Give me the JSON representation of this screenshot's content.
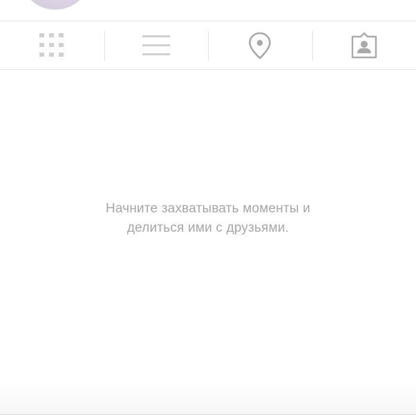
{
  "profile": {
    "avatar": "profile-avatar"
  },
  "tabs": [
    {
      "icon": "grid-icon",
      "active": false
    },
    {
      "icon": "list-icon",
      "active": false
    },
    {
      "icon": "location-pin-icon",
      "active": false
    },
    {
      "icon": "tagged-person-icon",
      "active": false
    }
  ],
  "empty_state": {
    "message": "Начните захватывать моменты и\nделиться ими с друзьями."
  },
  "colors": {
    "icon": "#a9a9a9",
    "icon_light": "#d0d0d0",
    "text_muted": "#a6a6a6",
    "divider": "#e4e4e4"
  }
}
